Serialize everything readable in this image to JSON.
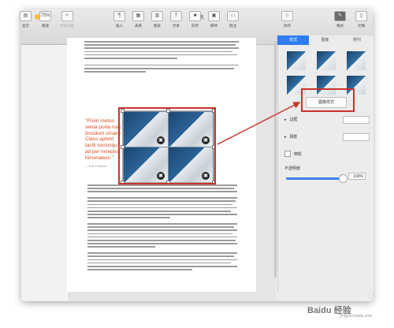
{
  "window": {
    "title": "未命名"
  },
  "toolbar": {
    "items": [
      {
        "icon": "view-icon",
        "label": "显示",
        "glyph": "▤"
      },
      {
        "icon": "zoom-icon",
        "label": "缩放",
        "glyph": "75%"
      },
      {
        "icon": "add-page-icon",
        "label": "添加页面",
        "glyph": "+"
      },
      {
        "icon": "insert-icon",
        "label": "插入",
        "glyph": "¶"
      },
      {
        "icon": "table-icon",
        "label": "表格",
        "glyph": "▦"
      },
      {
        "icon": "chart-icon",
        "label": "图表",
        "glyph": "▥"
      },
      {
        "icon": "text-icon",
        "label": "文本",
        "glyph": "T"
      },
      {
        "icon": "shape-icon",
        "label": "形状",
        "glyph": "■"
      },
      {
        "icon": "media-icon",
        "label": "媒体",
        "glyph": "▣"
      },
      {
        "icon": "comment-icon",
        "label": "批注",
        "glyph": "▭"
      },
      {
        "icon": "collaborate-icon",
        "label": "协作",
        "glyph": "☺"
      },
      {
        "icon": "format-icon",
        "label": "格式",
        "glyph": "✎"
      },
      {
        "icon": "document-icon",
        "label": "文稿",
        "glyph": "▯"
      }
    ]
  },
  "inspector": {
    "tabs": [
      {
        "label": "样式",
        "active": true
      },
      {
        "label": "图像",
        "active": false
      },
      {
        "label": "排列",
        "active": false
      }
    ],
    "image_style_button": "图像样式",
    "border_label": "边框",
    "shadow_label": "阴影",
    "reflection_label": "倒影",
    "opacity_label": "不透明度",
    "opacity_value": "100%",
    "opacity_fraction": 1.0
  },
  "document": {
    "pull_quote": "\"Proin metus\nvenia porta non,\ntincidunt ornare\nClass aptent\ntaciti sociosqu\nad per inceptos\nhimenaeos.\"",
    "attribution": "— Eric Preston"
  },
  "watermark": {
    "text": "Baidu 经验",
    "sub": "jingyan.baidu.com"
  },
  "colors": {
    "accent": "#2e7cf6",
    "quote": "#e04a1f",
    "annotation": "#c8342a"
  }
}
